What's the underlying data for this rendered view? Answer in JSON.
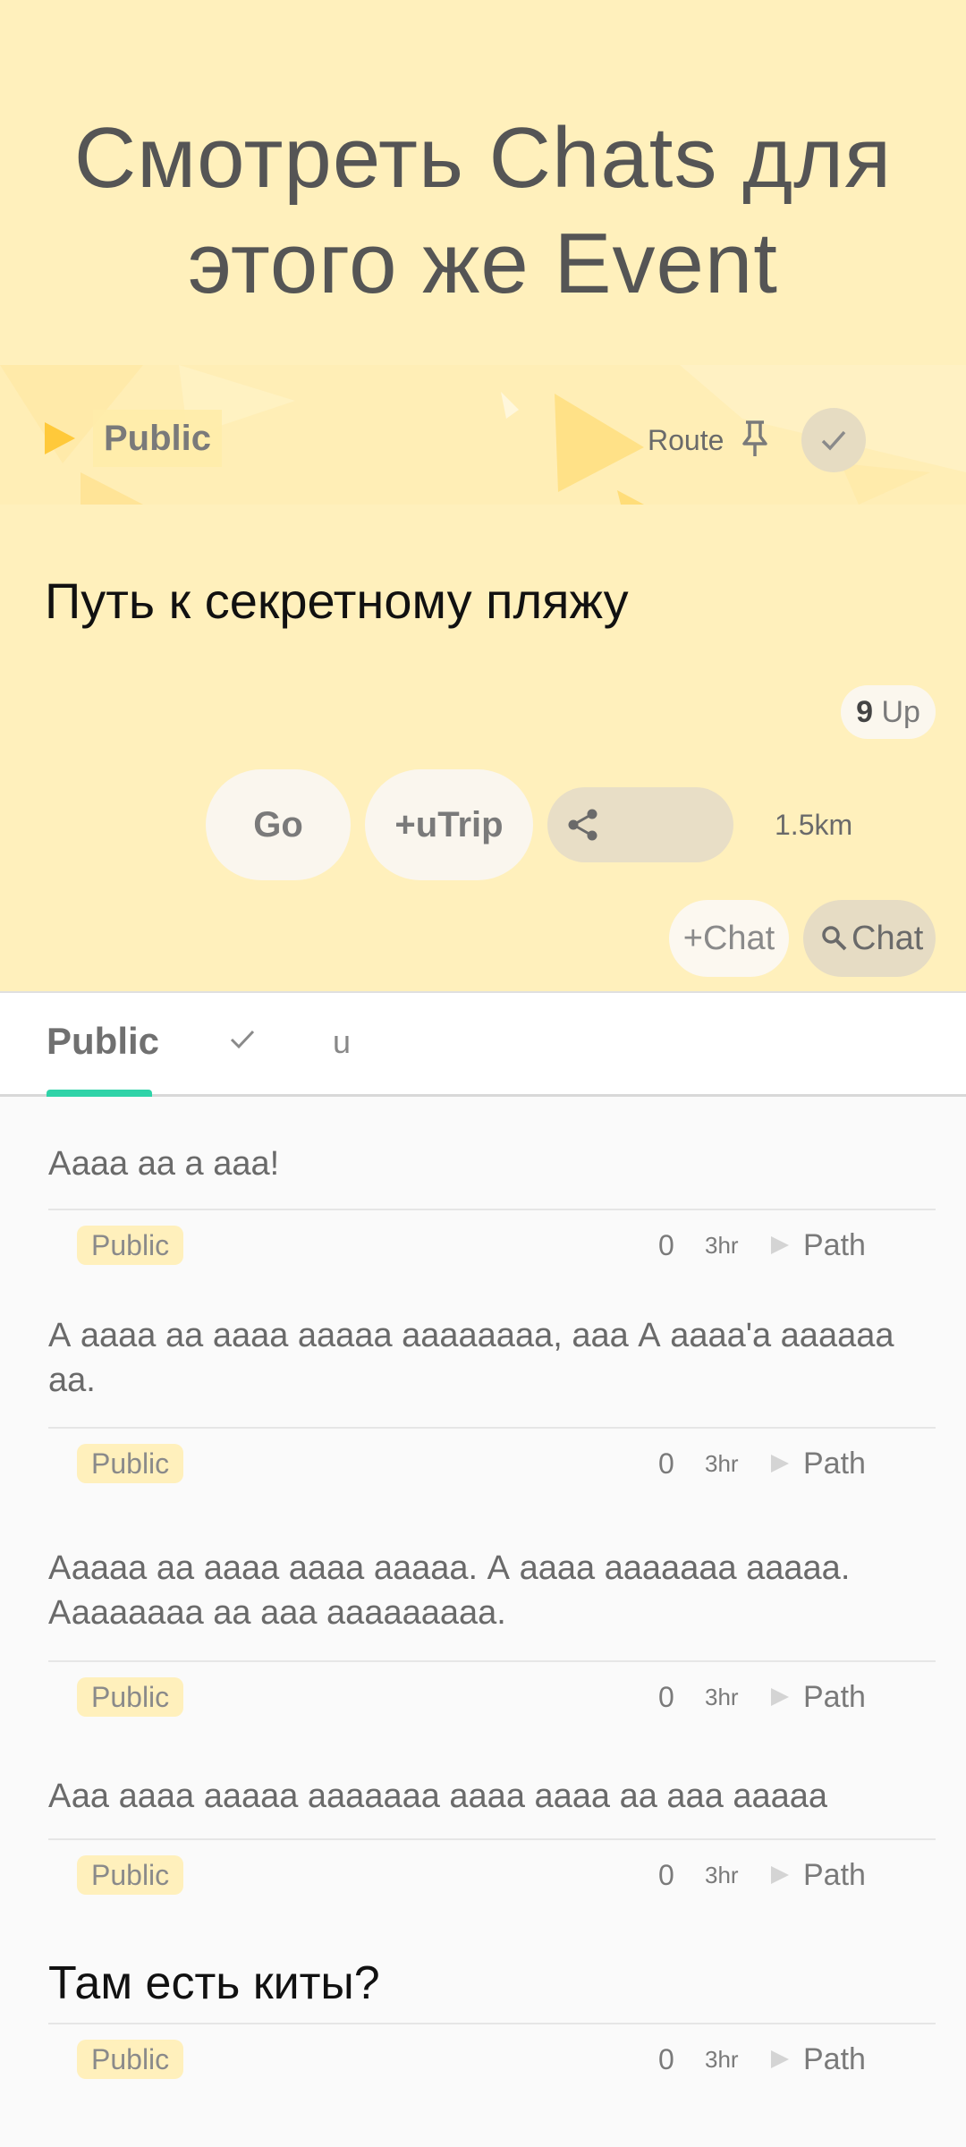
{
  "promo": {
    "line1": "Смотреть Chats для",
    "line2": "этого же Event"
  },
  "banner": {
    "title": "Public",
    "route_label": "Route",
    "pin_icon": "pin-icon",
    "check_icon": "check-icon"
  },
  "route": {
    "title": "Путь к секретному пляжу",
    "up_count": "9",
    "up_label": "Up",
    "go_label": "Go",
    "utrip_label": "+uTrip",
    "share_icon": "share-icon",
    "distance": "1.5km",
    "add_chat_label": "+Chat",
    "search_chat_label": "Chat"
  },
  "tabs": {
    "public": "Public",
    "check_icon": "check-icon",
    "u": "u",
    "indicator_color": "#2fd3a8"
  },
  "posts": [
    {
      "text": "Аааа аа а ааа!",
      "tag": "Public",
      "count": "0",
      "time": "3hr",
      "path": "Path"
    },
    {
      "text": "А аааа аа аааа ааааа аааааааа, ааа А аааа'а аааааа аа.",
      "tag": "Public",
      "count": "0",
      "time": "3hr",
      "path": "Path"
    },
    {
      "text": "Ааааа аа аааа аааа ааааа. А аааа ааааааа ааааа. Аааааааа аа ааа ааааааааа.",
      "tag": "Public",
      "count": "0",
      "time": "3hr",
      "path": "Path"
    },
    {
      "text": "Ааа аааа ааааа ааааааа аааа аааа аа ааа ааааа",
      "tag": "Public",
      "count": "0",
      "time": "3hr",
      "path": "Path"
    },
    {
      "text": "Там есть киты?",
      "tag": "Public",
      "count": "0",
      "time": "3hr",
      "path": "Path"
    }
  ],
  "colors": {
    "header_bg": "#fff0bc",
    "tag_bg": "#fff0bc",
    "accent": "#2fd3a8"
  }
}
